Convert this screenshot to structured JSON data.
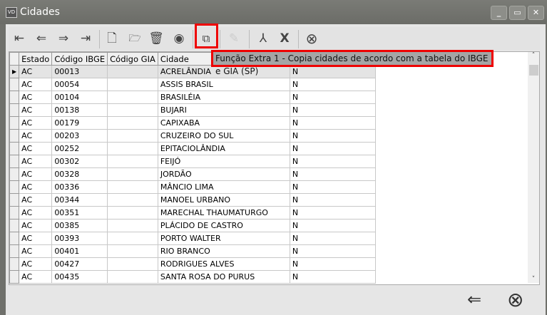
{
  "window": {
    "title": "Cidades",
    "icon_text": "VD"
  },
  "toolbar": {
    "icons": [
      "first-icon",
      "previous-icon",
      "next-icon",
      "last-icon",
      "new-icon",
      "open-icon",
      "delete-icon",
      "view-icon",
      "copy-icon",
      "edit-icon",
      "pdf-icon",
      "excel-icon",
      "close-icon"
    ]
  },
  "tooltip": "Função Extra 1 - Copia cidades de acordo com a tabela do IBGE e GIA (SP)",
  "table": {
    "columns": [
      "Estado",
      "Código IBGE",
      "Código GIA",
      "Cidade",
      ""
    ],
    "rows": [
      [
        "AC",
        "00013",
        "",
        "ACRELÂNDIA",
        "N"
      ],
      [
        "AC",
        "00054",
        "",
        "ASSIS BRASIL",
        "N"
      ],
      [
        "AC",
        "00104",
        "",
        "BRASILÉIA",
        "N"
      ],
      [
        "AC",
        "00138",
        "",
        "BUJARI",
        "N"
      ],
      [
        "AC",
        "00179",
        "",
        "CAPIXABA",
        "N"
      ],
      [
        "AC",
        "00203",
        "",
        "CRUZEIRO DO SUL",
        "N"
      ],
      [
        "AC",
        "00252",
        "",
        "EPITACIOLÂNDIA",
        "N"
      ],
      [
        "AC",
        "00302",
        "",
        "FEIJÓ",
        "N"
      ],
      [
        "AC",
        "00328",
        "",
        "JORDÃO",
        "N"
      ],
      [
        "AC",
        "00336",
        "",
        "MÂNCIO LIMA",
        "N"
      ],
      [
        "AC",
        "00344",
        "",
        "MANOEL URBANO",
        "N"
      ],
      [
        "AC",
        "00351",
        "",
        "MARECHAL THAUMATURGO",
        "N"
      ],
      [
        "AC",
        "00385",
        "",
        "PLÁCIDO DE CASTRO",
        "N"
      ],
      [
        "AC",
        "00393",
        "",
        "PORTO WALTER",
        "N"
      ],
      [
        "AC",
        "00401",
        "",
        "RIO BRANCO",
        "N"
      ],
      [
        "AC",
        "00427",
        "",
        "RODRIGUES ALVES",
        "N"
      ],
      [
        "AC",
        "00435",
        "",
        "SANTA ROSA DO PURUS",
        "N"
      ]
    ]
  },
  "colors": {
    "highlight": "#e00000",
    "titlebar": "#6f706b"
  }
}
